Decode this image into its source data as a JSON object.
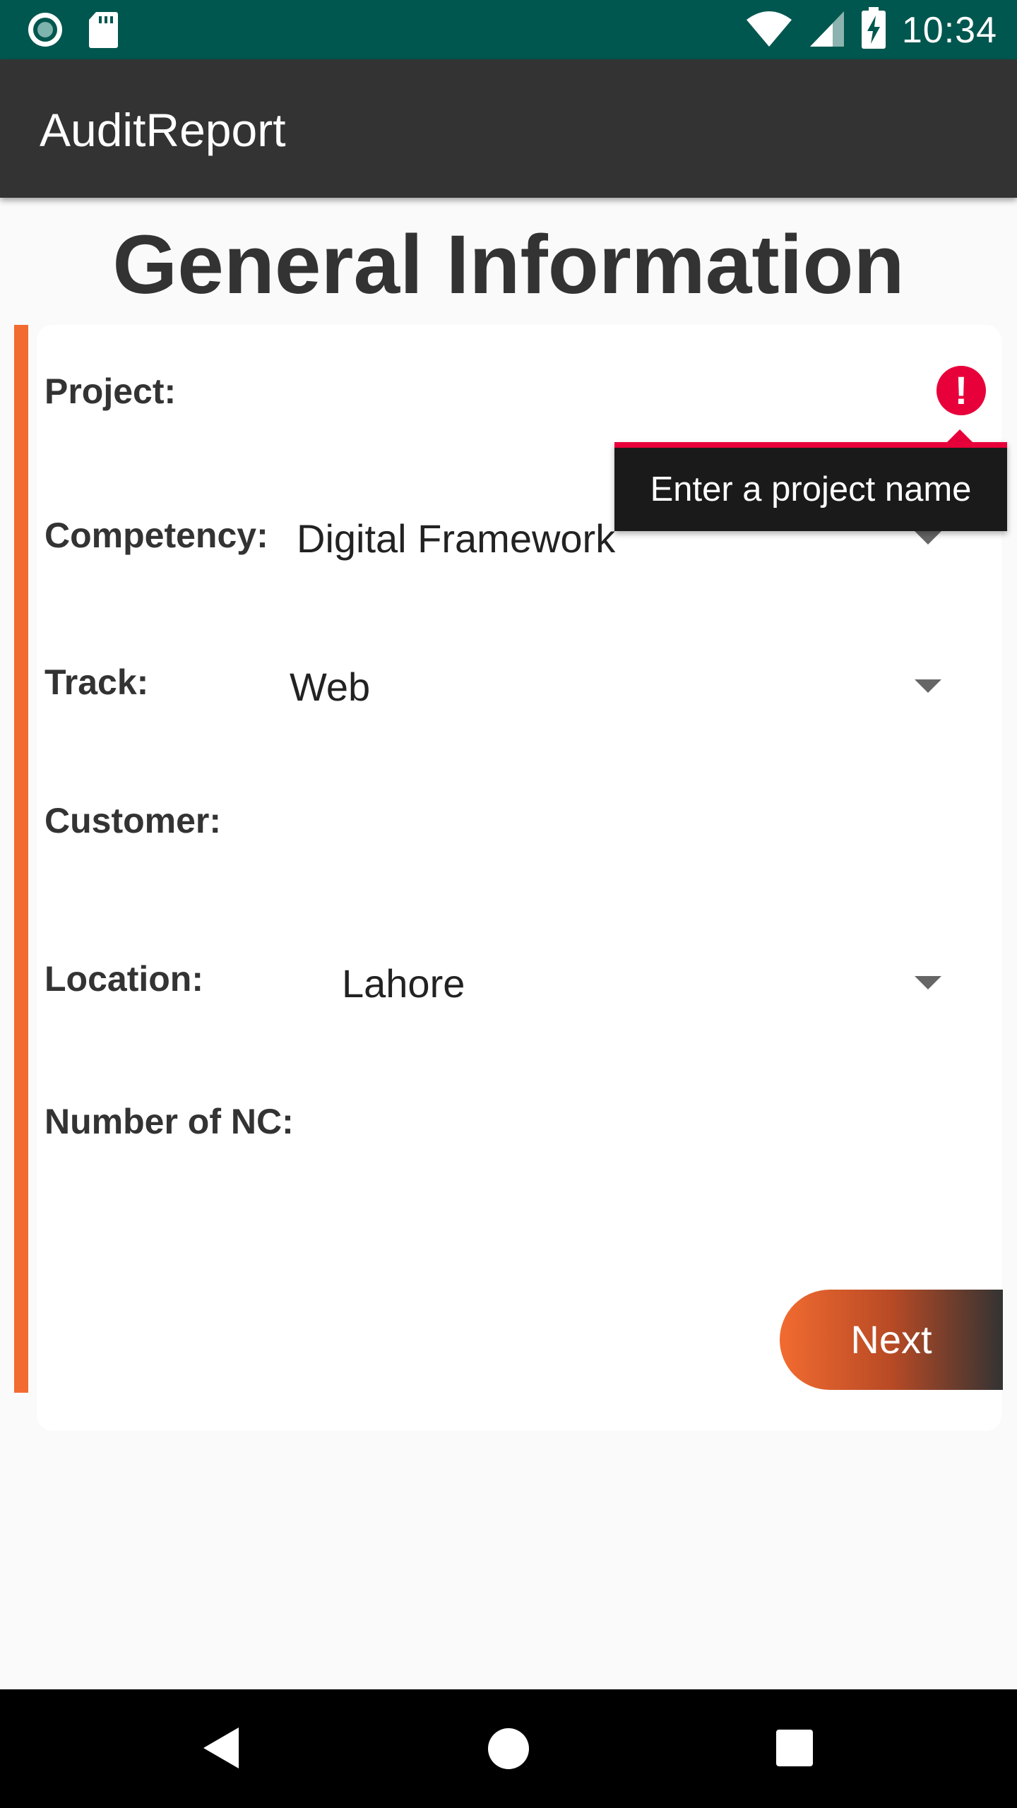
{
  "status_bar": {
    "time": "10:34",
    "left_icons": [
      "circle-notification-icon",
      "sd-card-icon"
    ],
    "right_icons": [
      "wifi-icon",
      "cell-signal-icon",
      "battery-charging-icon"
    ],
    "background": "#00574f"
  },
  "app_bar": {
    "title": "AuditReport",
    "background": "#333333"
  },
  "page": {
    "heading": "General Information"
  },
  "form": {
    "accent_color": "#f26b30",
    "project": {
      "label": "Project:",
      "value": "",
      "error_icon": "error-icon",
      "error_message": "Enter a project name",
      "error_color": "#e8003a"
    },
    "competency": {
      "label": "Competency:",
      "value": "Digital Framework"
    },
    "track": {
      "label": "Track:",
      "value": "Web"
    },
    "customer": {
      "label": "Customer:",
      "value": ""
    },
    "location": {
      "label": "Location:",
      "value": "Lahore"
    },
    "number_of_nc": {
      "label": "Number of NC:",
      "value": ""
    },
    "next_label": "Next"
  },
  "nav_bar": {
    "icons": [
      "back-icon",
      "home-icon",
      "recents-icon"
    ]
  }
}
